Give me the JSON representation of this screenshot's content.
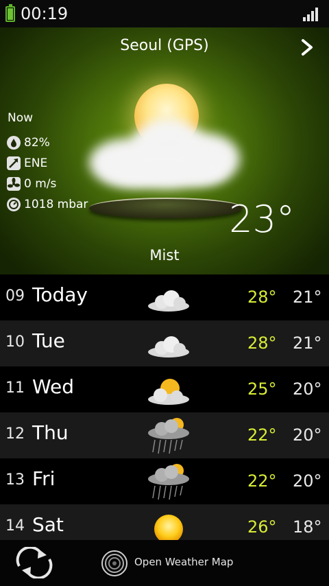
{
  "status_bar": {
    "time": "00:19",
    "battery_icon": "battery-icon",
    "signal_icon": "signal-strength-icon"
  },
  "header": {
    "city": "Seoul (GPS)",
    "next_icon": "chevron-right-icon"
  },
  "current": {
    "now_label": "Now",
    "humidity": "82%",
    "wind_direction": "ENE",
    "wind_speed": "0 m/s",
    "pressure": "1018 mbar",
    "temperature": "23°",
    "condition": "Mist",
    "icon": "sun-behind-cloud-icon"
  },
  "forecast": [
    {
      "day_num": "09",
      "day": "Today",
      "high": "28°",
      "low": "21°",
      "icon": "cloud-icon"
    },
    {
      "day_num": "10",
      "day": "Tue",
      "high": "28°",
      "low": "21°",
      "icon": "cloud-icon"
    },
    {
      "day_num": "11",
      "day": "Wed",
      "high": "25°",
      "low": "20°",
      "icon": "partly-cloudy-icon"
    },
    {
      "day_num": "12",
      "day": "Thu",
      "high": "22°",
      "low": "20°",
      "icon": "rain-icon"
    },
    {
      "day_num": "13",
      "day": "Fri",
      "high": "22°",
      "low": "20°",
      "icon": "rain-icon"
    },
    {
      "day_num": "14",
      "day": "Sat",
      "high": "26°",
      "low": "18°",
      "icon": "sun-icon"
    }
  ],
  "bottom_bar": {
    "refresh_icon": "refresh-icon",
    "provider_label": "Open Weather Map",
    "provider_icon": "open-weather-map-logo"
  },
  "colors": {
    "accent_high_temp": "#d8ec36",
    "hero_green": "#4a700a",
    "row_alt": "#1a1a1a"
  }
}
